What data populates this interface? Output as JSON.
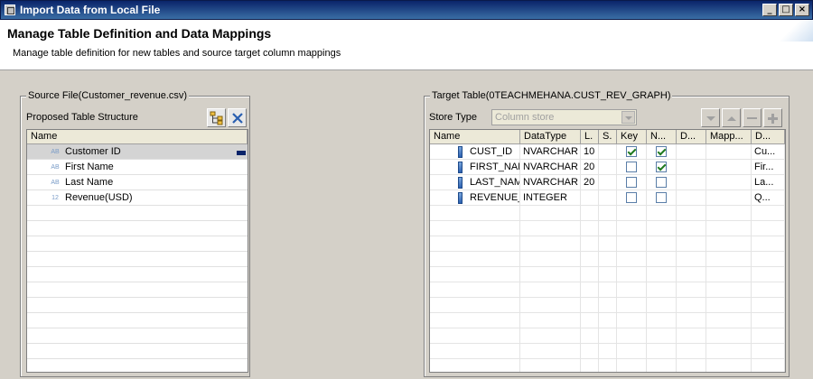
{
  "window": {
    "title": "Import Data from Local File",
    "controls": {
      "minimize": "_",
      "maximize": "□",
      "close": "×"
    }
  },
  "header": {
    "title": "Manage Table Definition and Data Mappings",
    "subtitle": "Manage table definition for new tables and source target column mappings"
  },
  "source": {
    "group_title": "Source File(Customer_revenue.csv)",
    "proposed_label": "Proposed Table Structure",
    "column_header": "Name",
    "items": [
      {
        "type_glyph": "AB",
        "name": "Customer ID",
        "selected": true
      },
      {
        "type_glyph": "AB",
        "name": "First Name"
      },
      {
        "type_glyph": "AB",
        "name": "Last Name"
      },
      {
        "type_glyph": "12",
        "name": "Revenue(USD)"
      }
    ],
    "icons": {
      "tree": "tree-icon",
      "delete": "delete-icon"
    }
  },
  "target": {
    "group_title": "Target Table(0TEACHMEHANA.CUST_REV_GRAPH)",
    "store_type_label": "Store Type",
    "store_type_value": "Column store",
    "columns": [
      "Name",
      "DataType",
      "L.",
      "S.",
      "Key",
      "N...",
      "D...",
      "Mapp...",
      "D..."
    ],
    "rows": [
      {
        "name": "CUST_ID",
        "datatype": "NVARCHAR",
        "length": "10",
        "key": true,
        "notnull": true,
        "desc": "Cu..."
      },
      {
        "name": "FIRST_NAME",
        "datatype": "NVARCHAR",
        "length": "20",
        "key": false,
        "notnull": true,
        "desc": "Fir..."
      },
      {
        "name": "LAST_NAME",
        "datatype": "NVARCHAR",
        "length": "20",
        "key": false,
        "notnull": false,
        "desc": "La..."
      },
      {
        "name": "REVENUE_USD",
        "datatype": "INTEGER",
        "length": "",
        "key": false,
        "notnull": false,
        "desc": "Q..."
      }
    ]
  }
}
